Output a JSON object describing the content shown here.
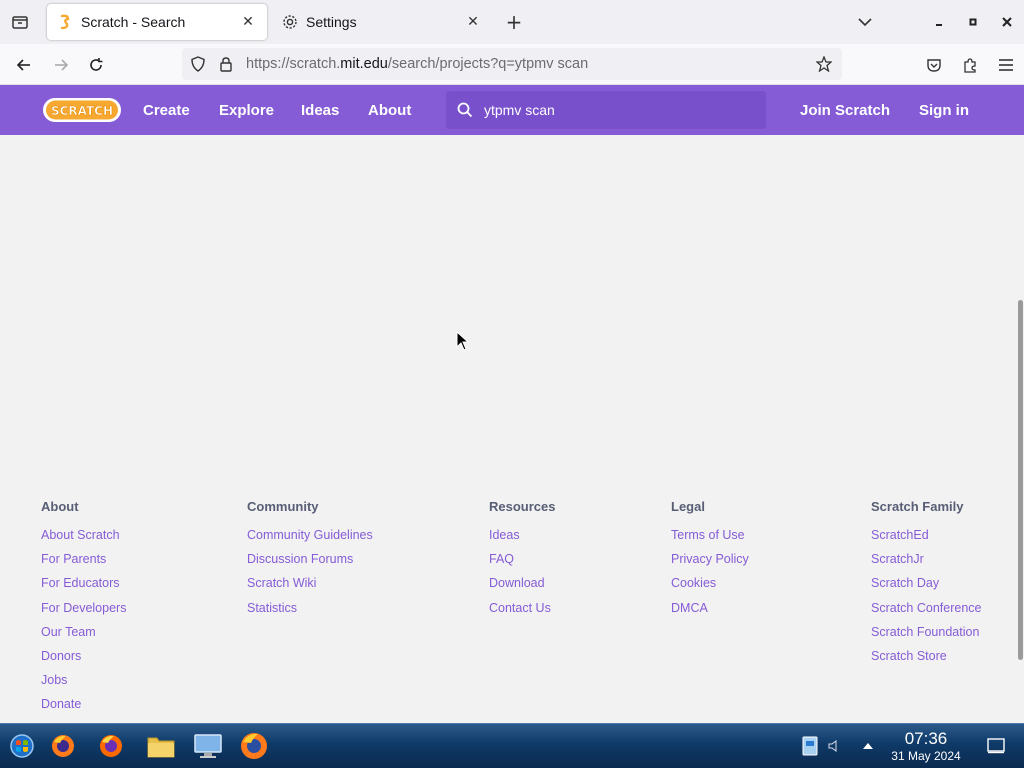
{
  "browser": {
    "tabs": [
      {
        "title": "Scratch - Search",
        "active": true
      },
      {
        "title": "Settings",
        "active": false
      }
    ],
    "url": {
      "prefix": "https://scratch.",
      "host": "mit.edu",
      "path": "/search/projects?q=ytpmv scan"
    }
  },
  "scratch": {
    "logo": "SCRATCH",
    "nav": [
      "Create",
      "Explore",
      "Ideas",
      "About"
    ],
    "search": {
      "value": "ytpmv scan",
      "placeholder": "Search"
    },
    "join": "Join Scratch",
    "signin": "Sign in"
  },
  "footer": {
    "columns": [
      {
        "heading": "About",
        "links": [
          "About Scratch",
          "For Parents",
          "For Educators",
          "For Developers",
          "Our Team",
          "Donors",
          "Jobs",
          "Donate"
        ]
      },
      {
        "heading": "Community",
        "links": [
          "Community Guidelines",
          "Discussion Forums",
          "Scratch Wiki",
          "Statistics"
        ]
      },
      {
        "heading": "Resources",
        "links": [
          "Ideas",
          "FAQ",
          "Download",
          "Contact Us"
        ]
      },
      {
        "heading": "Legal",
        "links": [
          "Terms of Use",
          "Privacy Policy",
          "Cookies",
          "DMCA"
        ]
      },
      {
        "heading": "Scratch Family",
        "links": [
          "ScratchEd",
          "ScratchJr",
          "Scratch Day",
          "Scratch Conference",
          "Scratch Foundation",
          "Scratch Store"
        ]
      }
    ]
  },
  "taskbar": {
    "time": "07:36",
    "date": "31 May 2024"
  },
  "colors": {
    "scratch_purple": "#855cd6",
    "footer_heading": "#575e75",
    "footer_link": "#855cd6"
  }
}
